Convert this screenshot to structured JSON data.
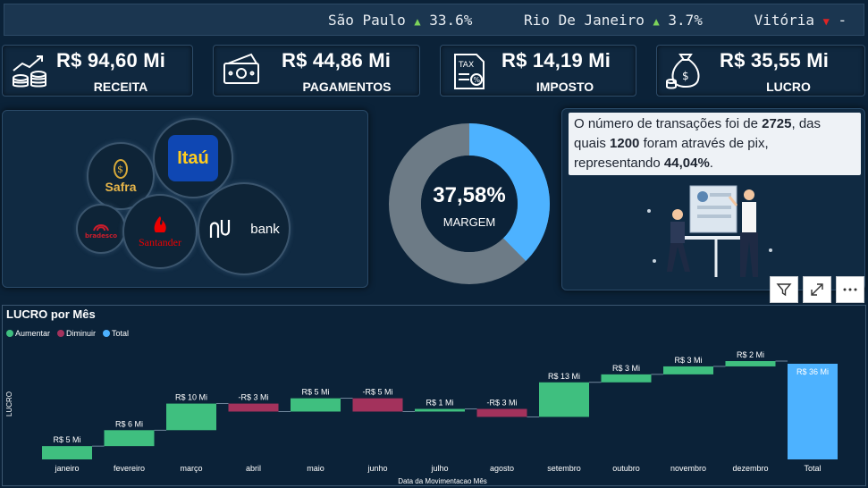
{
  "ticker": {
    "items": [
      {
        "city": "São Paulo",
        "dir": "up",
        "arrow": "▲",
        "pct": "33.6%"
      },
      {
        "city": "Rio De Janeiro",
        "dir": "up",
        "arrow": "▲",
        "pct": "3.7%"
      },
      {
        "city": "Vitória",
        "dir": "down",
        "arrow": "▼",
        "pct": "-"
      }
    ]
  },
  "kpis": [
    {
      "value": "R$ 94,60 Mi",
      "label": "RECEITA",
      "icon": "revenue-chart-coins-icon"
    },
    {
      "value": "R$ 44,86 Mi",
      "label": "PAGAMENTOS",
      "icon": "banknotes-icon"
    },
    {
      "value": "R$ 14,19 Mi",
      "label": "IMPOSTO",
      "icon": "tax-document-icon"
    },
    {
      "value": "R$ 35,55 Mi",
      "label": "LUCRO",
      "icon": "money-bag-icon"
    }
  ],
  "banks": {
    "safra": "Safra",
    "itau": "Itaú",
    "bradesco": "bradesco",
    "santander": "Santander",
    "nubank": "bank"
  },
  "donut": {
    "value": "37,58%",
    "label": "MARGEM",
    "fraction": 0.3758,
    "color_fill": "#4db2ff",
    "color_rest": "#6d7b86"
  },
  "insight": {
    "t1": "O número de transações foi de ",
    "n1": "2725",
    "t2": ", das quais ",
    "n2": "1200",
    "t3": " foram através de pix, representando ",
    "n3": "44,04%",
    "t4": "."
  },
  "visual_tools": {
    "filter": "filter-icon",
    "focus": "focus-mode-icon",
    "more": "more-options-icon"
  },
  "chart_data": {
    "type": "waterfall",
    "title": "LUCRO por Mês",
    "xlabel": "Data da Movimentacao Mês",
    "ylabel": "LUCRO",
    "legend": [
      {
        "name": "Aumentar",
        "color": "#3fbf7f"
      },
      {
        "name": "Diminuir",
        "color": "#a3325c"
      },
      {
        "name": "Total",
        "color": "#4db2ff"
      }
    ],
    "categories": [
      "janeiro",
      "fevereiro",
      "março",
      "abril",
      "maio",
      "junho",
      "julho",
      "agosto",
      "setembro",
      "outubro",
      "novembro",
      "dezembro",
      "Total"
    ],
    "values": [
      5,
      6,
      10,
      -3,
      5,
      -5,
      1,
      -3,
      13,
      3,
      3,
      2,
      36
    ],
    "labels": [
      "R$ 5 Mi",
      "R$ 6 Mi",
      "R$ 10 Mi",
      "-R$ 3 Mi",
      "R$ 5 Mi",
      "-R$ 5 Mi",
      "R$ 1 Mi",
      "-R$ 3 Mi",
      "R$ 13 Mi",
      "R$ 3 Mi",
      "R$ 3 Mi",
      "R$ 2 Mi",
      "R$ 36 Mi"
    ],
    "ylim": [
      0,
      37
    ],
    "grid": false,
    "legend_position": "top-left"
  }
}
